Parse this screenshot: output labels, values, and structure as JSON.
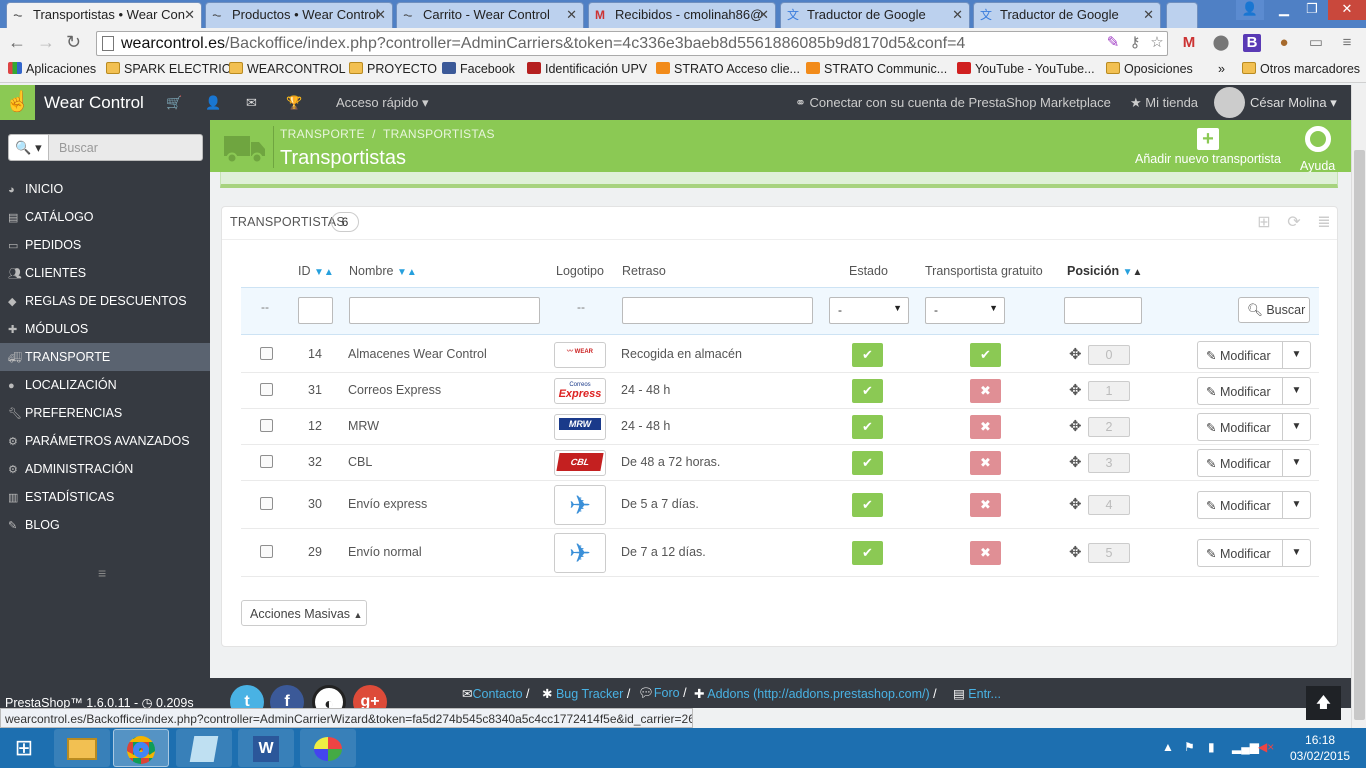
{
  "browser": {
    "tabs": [
      {
        "title": "Transportistas • Wear Con",
        "active": true,
        "icon": "wearcontrol-icon"
      },
      {
        "title": "Productos • Wear Control",
        "active": false,
        "icon": "wearcontrol-icon"
      },
      {
        "title": "Carrito - Wear Control",
        "active": false,
        "icon": "wearcontrol-icon"
      },
      {
        "title": "Recibidos - cmolinah86@",
        "active": false,
        "icon": "gmail-icon"
      },
      {
        "title": "Traductor de Google",
        "active": false,
        "icon": "translate-icon"
      },
      {
        "title": "Traductor de Google",
        "active": false,
        "icon": "translate-icon"
      }
    ],
    "url_host": "wearcontrol.es",
    "url_rest": "/Backoffice/index.php?controller=AdminCarriers&token=4c336e3baeb8d5561886085b9d8170d5&conf=4",
    "bookmarks": [
      {
        "label": "Aplicaciones",
        "icon": "apps-icon"
      },
      {
        "label": "SPARK ELECTRIC",
        "icon": "folder-icon"
      },
      {
        "label": "WEARCONTROL",
        "icon": "folder-icon"
      },
      {
        "label": "PROYECTO",
        "icon": "folder-icon"
      },
      {
        "label": "Facebook",
        "icon": "facebook-icon"
      },
      {
        "label": "Identificación UPV",
        "icon": "upv-icon"
      },
      {
        "label": "STRATO Acceso clie...",
        "icon": "strato-icon"
      },
      {
        "label": "STRATO Communic...",
        "icon": "strato-icon"
      },
      {
        "label": "YouTube - YouTube...",
        "icon": "youtube-icon"
      },
      {
        "label": "Oposiciones",
        "icon": "folder-icon"
      }
    ],
    "more_bookmarks": "»",
    "other_bookmarks": "Otros marcadores",
    "status_url": "wearcontrol.es/Backoffice/index.php?controller=AdminCarrierWizard&token=fa5d274b545c8340a5c4cc1772414f5e&id_carrier=26#"
  },
  "header": {
    "brand": "Wear Control",
    "quick_access": "Acceso rápido",
    "marketplace": "Conectar con su cuenta de PrestaShop Marketplace",
    "my_store": "Mi tienda",
    "user": "César Molina"
  },
  "sidebar": {
    "search_placeholder": "Buscar",
    "items": [
      {
        "label": "INICIO",
        "icon": "dashboard-icon",
        "active": false
      },
      {
        "label": "CATÁLOGO",
        "icon": "book-icon",
        "active": false
      },
      {
        "label": "PEDIDOS",
        "icon": "credit-card-icon",
        "active": false
      },
      {
        "label": "CLIENTES",
        "icon": "users-icon",
        "active": false
      },
      {
        "label": "REGLAS DE DESCUENTOS",
        "icon": "tag-icon",
        "active": false
      },
      {
        "label": "MÓDULOS",
        "icon": "puzzle-icon",
        "active": false
      },
      {
        "label": "TRANSPORTE",
        "icon": "truck-icon",
        "active": true
      },
      {
        "label": "LOCALIZACIÓN",
        "icon": "globe-icon",
        "active": false
      },
      {
        "label": "PREFERENCIAS",
        "icon": "wrench-icon",
        "active": false
      },
      {
        "label": "PARÁMETROS AVANZADOS",
        "icon": "cogs-icon",
        "active": false
      },
      {
        "label": "ADMINISTRACIÓN",
        "icon": "cog-icon",
        "active": false
      },
      {
        "label": "ESTADÍSTICAS",
        "icon": "bar-chart-icon",
        "active": false
      },
      {
        "label": "BLOG",
        "icon": "edit-icon",
        "active": false
      }
    ]
  },
  "page": {
    "breadcrumb1": "TRANSPORTE",
    "breadcrumb_sep": "/",
    "breadcrumb2": "TRANSPORTISTAS",
    "title": "Transportistas",
    "add_button": "Añadir nuevo transportista",
    "help_button": "Ayuda"
  },
  "panel": {
    "title": "TRANSPORTISTAS",
    "count": "6",
    "columns": {
      "id": "ID",
      "name": "Nombre",
      "logo": "Logotipo",
      "delay": "Retraso",
      "status": "Estado",
      "free": "Transportista gratuito",
      "position": "Posición"
    },
    "filter_dash": "--",
    "filter_select": "-",
    "search_button": "Buscar",
    "rows": [
      {
        "id": "14",
        "name": "Almacenes Wear Control",
        "delay": "Recogida en almacén",
        "active": true,
        "free": true,
        "position": "0",
        "logo": "wearcontrol"
      },
      {
        "id": "31",
        "name": "Correos Express",
        "delay": "24 - 48 h",
        "active": true,
        "free": false,
        "position": "1",
        "logo": "correos"
      },
      {
        "id": "12",
        "name": "MRW",
        "delay": "24 - 48 h",
        "active": true,
        "free": false,
        "position": "2",
        "logo": "mrw"
      },
      {
        "id": "32",
        "name": "CBL",
        "delay": "De 48 a 72 horas.",
        "active": true,
        "free": false,
        "position": "3",
        "logo": "cbl"
      },
      {
        "id": "30",
        "name": "Envío express",
        "delay": "De 5 a 7 días.",
        "active": true,
        "free": false,
        "position": "4",
        "logo": "plane"
      },
      {
        "id": "29",
        "name": "Envío normal",
        "delay": "De 7 a 12 días.",
        "active": true,
        "free": false,
        "position": "5",
        "logo": "plane"
      }
    ],
    "edit_label": "Modificar",
    "bulk_label": "Acciones Masivas"
  },
  "footer": {
    "version": "PrestaShop™ 1.6.0.11 - ",
    "time": "0.209s",
    "links": [
      "Contacto",
      "Bug Tracker",
      "Foro",
      "Addons (http://addons.prestashop.com/)",
      "Entr..."
    ],
    "link_sep": "/"
  },
  "logos": {
    "wearcontrol": "WEAR CONTROL",
    "correos_top": "Correos",
    "correos_main": "Express",
    "mrw": "MRW",
    "cbl": "CBL"
  },
  "taskbar": {
    "time": "16:18",
    "date": "03/02/2015"
  },
  "colors": {
    "brand_green": "#8bc954",
    "header_dark": "#363a41",
    "link_blue": "#49b2e4",
    "status_off": "#e08f95"
  }
}
